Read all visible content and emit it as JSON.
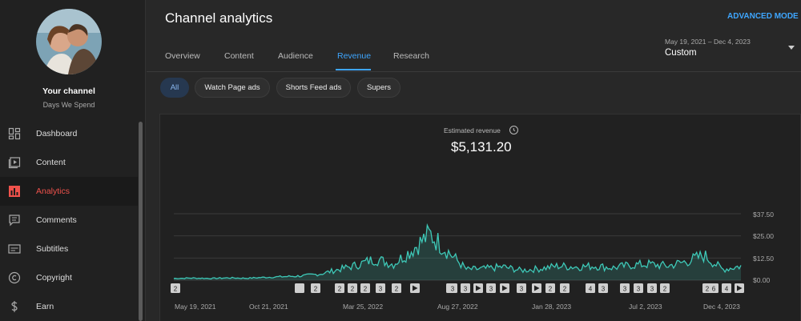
{
  "sidebar": {
    "channel_title": "Your channel",
    "channel_name": "Days We Spend",
    "items": [
      {
        "label": "Dashboard",
        "icon": "dashboard-icon"
      },
      {
        "label": "Content",
        "icon": "content-icon"
      },
      {
        "label": "Analytics",
        "icon": "analytics-icon",
        "active": true
      },
      {
        "label": "Comments",
        "icon": "comments-icon"
      },
      {
        "label": "Subtitles",
        "icon": "subtitles-icon"
      },
      {
        "label": "Copyright",
        "icon": "copyright-icon"
      },
      {
        "label": "Earn",
        "icon": "earn-icon"
      }
    ]
  },
  "header": {
    "title": "Channel analytics",
    "advanced_mode": "ADVANCED MODE",
    "tabs": [
      "Overview",
      "Content",
      "Audience",
      "Revenue",
      "Research"
    ],
    "active_tab": "Revenue",
    "date_range": "May 19, 2021 – Dec 4, 2023",
    "date_mode": "Custom"
  },
  "chips": [
    "All",
    "Watch Page ads",
    "Shorts Feed ads",
    "Supers"
  ],
  "selected_chip": "All",
  "metric": {
    "label": "Estimated revenue",
    "value": "$5,131.20"
  },
  "colors": {
    "accent": "#3ea6ff",
    "analytics_active": "#f0524c",
    "series_line": "#3ec9b8"
  },
  "chart_data": {
    "type": "area",
    "x_tick_labels": [
      "May 19, 2021",
      "Oct 21, 2021",
      "Mar 25, 2022",
      "Aug 27, 2022",
      "Jan 28, 2023",
      "Jul 2, 2023",
      "Dec 4, 2023"
    ],
    "y_tick_labels": [
      "$37.50",
      "$25.00",
      "$12.50",
      "$0.00"
    ],
    "ylim": [
      0,
      37.5
    ],
    "x": [
      "2021-05",
      "2021-06",
      "2021-07",
      "2021-08",
      "2021-09",
      "2021-10",
      "2021-11",
      "2021-12",
      "2022-01",
      "2022-02",
      "2022-03",
      "2022-04",
      "2022-05",
      "2022-06",
      "2022-07",
      "2022-08",
      "2022-09",
      "2022-10",
      "2022-11",
      "2022-12",
      "2023-01",
      "2023-02",
      "2023-03",
      "2023-04",
      "2023-05",
      "2023-06",
      "2023-07",
      "2023-08",
      "2023-09",
      "2023-10",
      "2023-11",
      "2023-12"
    ],
    "values": [
      1.0,
      1.2,
      1.0,
      1.3,
      1.1,
      1.6,
      2.0,
      2.4,
      3.5,
      6.0,
      8.5,
      12.0,
      9.0,
      17.0,
      26.0,
      16.0,
      6.0,
      6.5,
      7.5,
      5.5,
      6.5,
      8.0,
      7.5,
      8.0,
      7.0,
      8.5,
      9.0,
      8.0,
      10.5,
      14.0,
      6.0,
      8.0
    ],
    "grid": true,
    "marker_flags": [
      "2",
      "",
      "2",
      "2",
      "2",
      "2",
      "3",
      "2",
      "▶",
      "▶",
      "3",
      "3",
      "▶",
      "3",
      "▶",
      "3",
      "▶",
      "2",
      "2",
      "4",
      "3",
      "3",
      "3",
      "3",
      "2",
      "2",
      "6",
      "4",
      "▶"
    ]
  }
}
